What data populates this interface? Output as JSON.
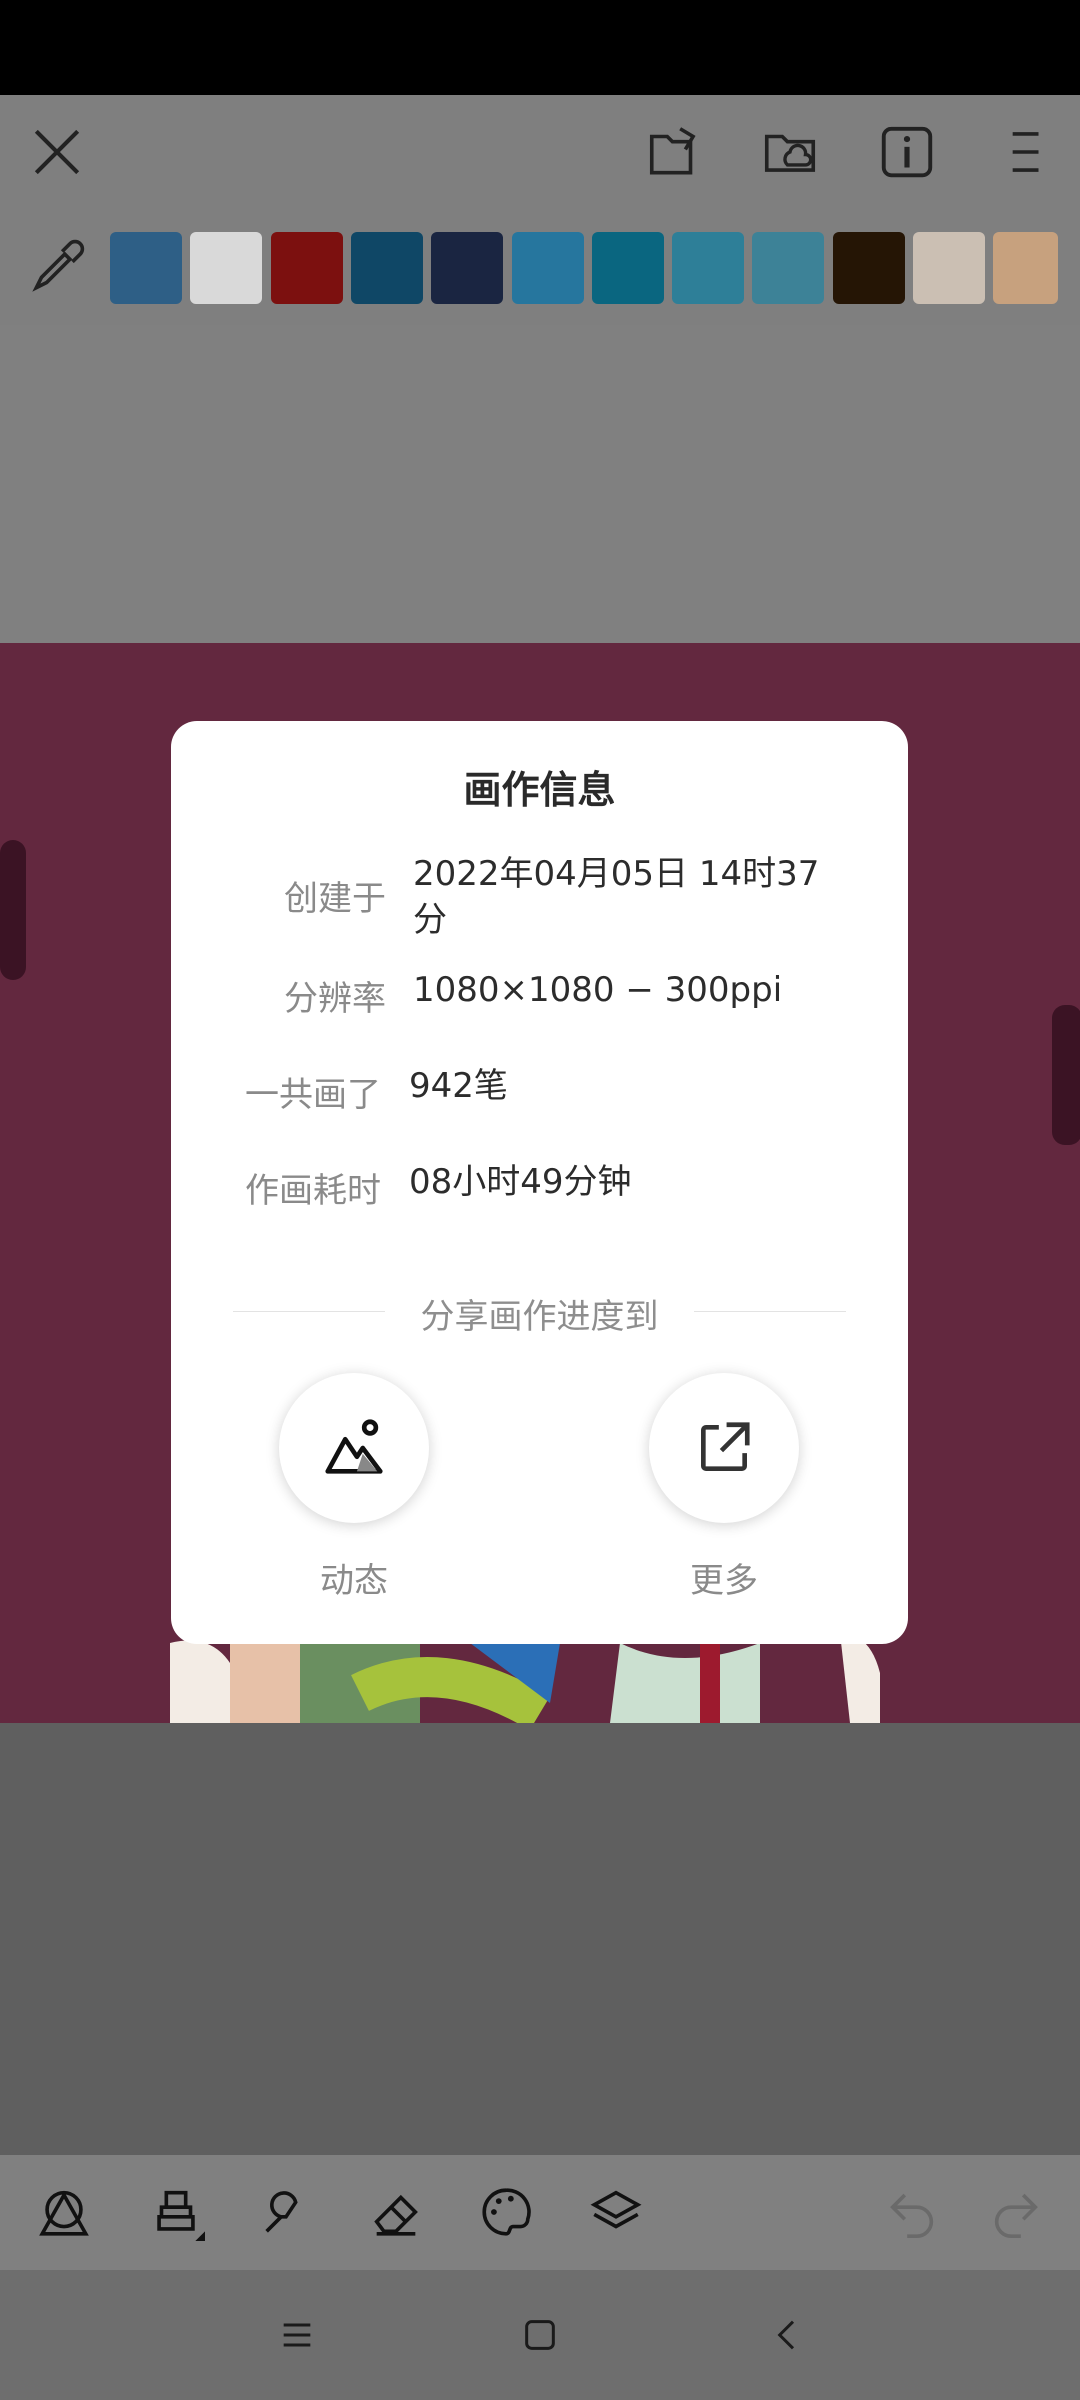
{
  "toolbar": {
    "close_icon": "close-icon",
    "icons": [
      "export-icon",
      "cloud-folder-icon",
      "info-icon",
      "more-menu-icon"
    ]
  },
  "palette": {
    "eyedropper_icon": "eyedropper-icon",
    "swatches": [
      "#2e5f86",
      "#d9d9d9",
      "#7c100f",
      "#0f4766",
      "#1a2541",
      "#26769e",
      "#0a6680",
      "#2e7f98",
      "#3d8297",
      "#251505",
      "#cbbfb3",
      "#c7a17e"
    ]
  },
  "dialog": {
    "title": "画作信息",
    "created_label": "创建于",
    "created_value": "2022年04月05日 14时37分",
    "resolution_label": "分辨率",
    "resolution_value": "1080×1080 − 300ppi",
    "strokes_label": "一共画了",
    "strokes_value": "942笔",
    "duration_label": "作画耗时",
    "duration_value": "08小时49分钟",
    "share_heading": "分享画作进度到",
    "share_moments_label": "动态",
    "share_more_label": "更多"
  },
  "bottom_tools": [
    "shapes-icon",
    "brush-icon",
    "smudge-icon",
    "eraser-icon",
    "palette-icon",
    "layers-icon",
    "undo-icon",
    "redo-icon"
  ],
  "nav": [
    "menu-icon",
    "home-icon",
    "back-icon"
  ]
}
